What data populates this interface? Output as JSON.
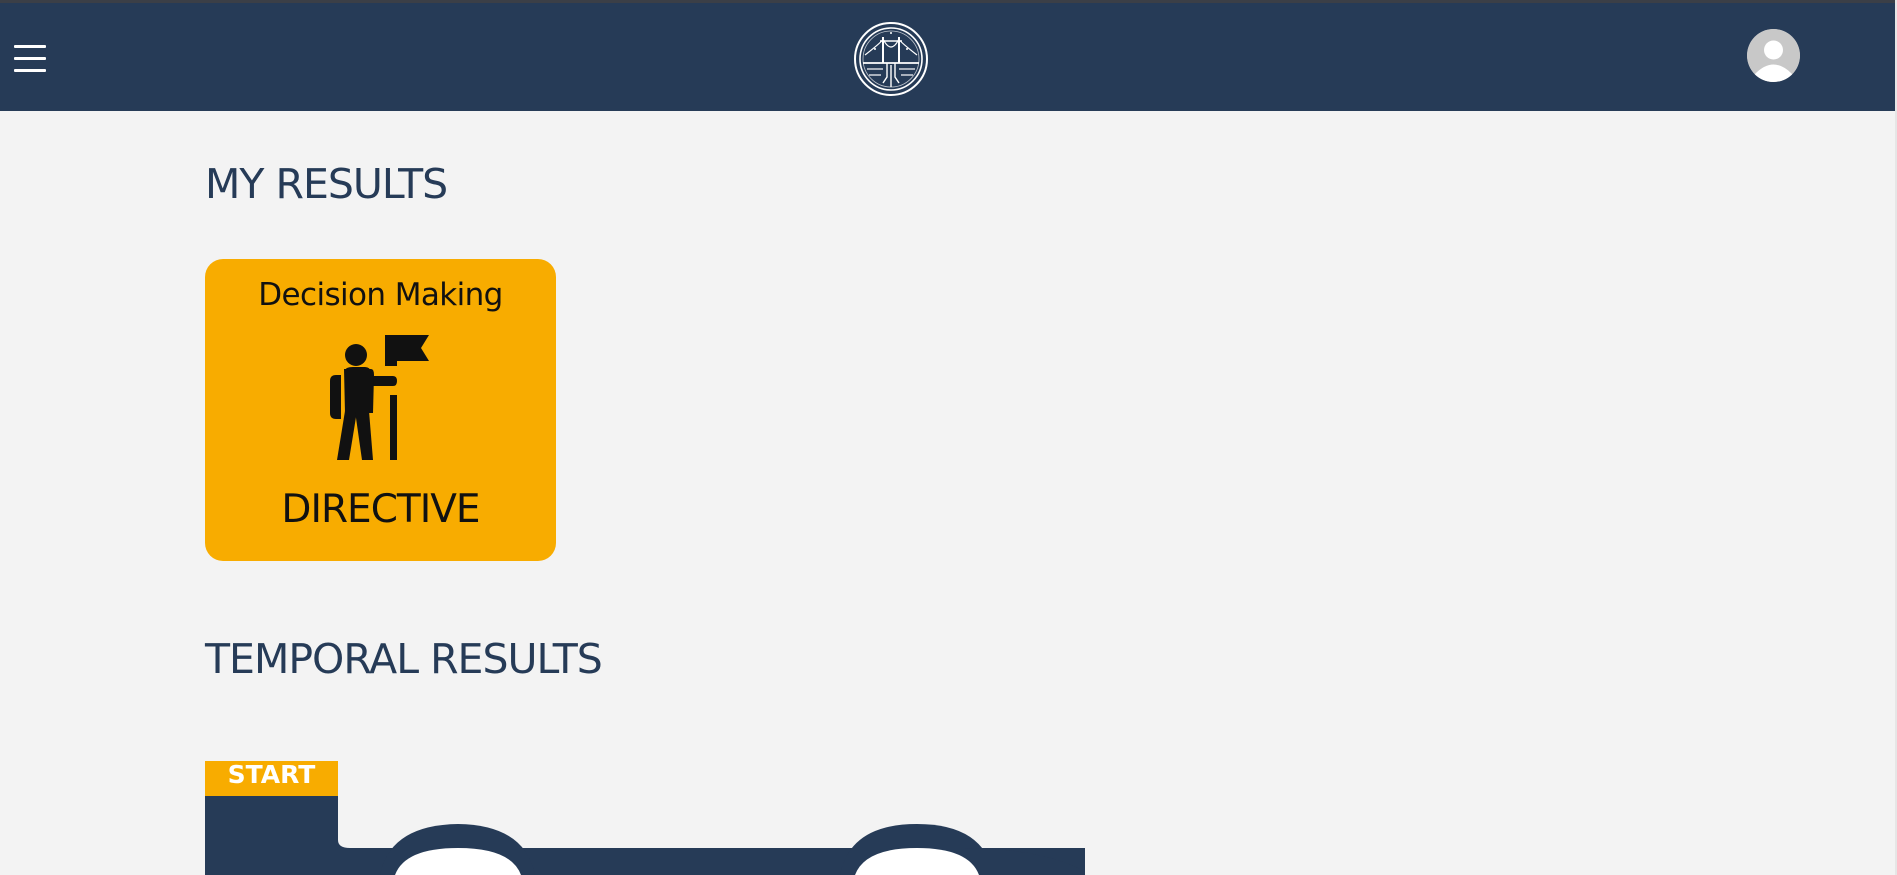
{
  "header": {
    "menu_icon": "hamburger-menu-icon",
    "logo_icon": "bridge-emblem-icon",
    "avatar_icon": "user-avatar-icon"
  },
  "my_results": {
    "title": "MY RESULTS",
    "cards": [
      {
        "category": "Decision Making",
        "icon": "hiker-with-flag-icon",
        "result": "DIRECTIVE",
        "color": "#f8ac00"
      }
    ]
  },
  "temporal_results": {
    "title": "TEMPORAL RESULTS",
    "start_label": "START",
    "track_color": "#263b57"
  },
  "colors": {
    "navbar": "#263b57",
    "accent": "#f8ac00",
    "background": "#f3f3f3",
    "title_text": "#263b57"
  }
}
